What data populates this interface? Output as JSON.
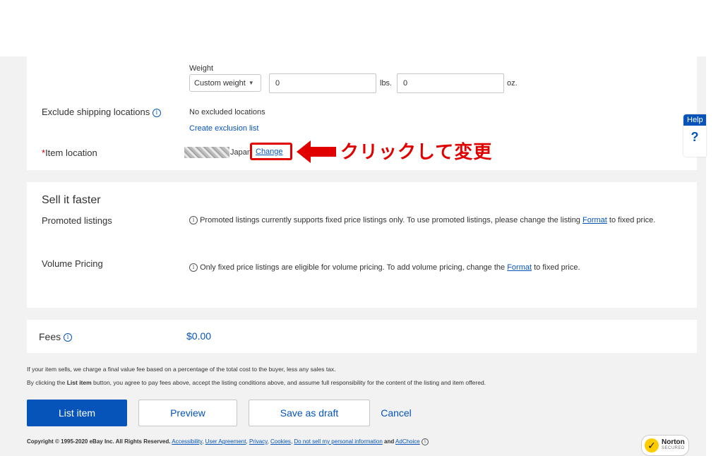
{
  "shipping": {
    "weight_label": "Weight",
    "weight_type": "Custom weight",
    "lbs_value": "0",
    "lbs_unit": "lbs.",
    "oz_value": "0",
    "oz_unit": "oz.",
    "exclude_label": "Exclude shipping locations",
    "exclude_value": "No excluded locations",
    "create_exclusion_link": "Create exclusion list",
    "item_location_required": "*",
    "item_location_label": "Item location",
    "item_location_country": "Japan",
    "change_link": "Change"
  },
  "annotation": {
    "text": "クリックして変更",
    "color": "#e10000"
  },
  "help": {
    "label": "Help",
    "icon": "question-icon"
  },
  "sell_faster": {
    "title": "Sell it faster",
    "promoted_label": "Promoted listings",
    "promoted_text": "Promoted listings currently supports fixed price listings only. To use promoted listings, please change the listing",
    "promoted_format_link": "Format",
    "promoted_tail": "to fixed price.",
    "volume_label": "Volume Pricing",
    "volume_text": "Only fixed price listings are eligible for volume pricing. To add volume pricing, change the",
    "volume_format_link": "Format",
    "volume_tail": "to fixed price."
  },
  "fees": {
    "label": "Fees",
    "amount": "$0.00",
    "disclaimer": "If your item sells, we charge a final value fee based on a percentage of the total cost to the buyer, less any sales tax.",
    "agree_prefix": "By clicking the",
    "agree_bold": "List item",
    "agree_suffix": "button, you agree to pay fees above, accept the listing conditions above, and assume full responsibility for the content of the listing and item offered."
  },
  "actions": {
    "list_item": "List item",
    "preview": "Preview",
    "save_draft": "Save as draft",
    "cancel": "Cancel"
  },
  "footer": {
    "copyright": "Copyright © 1995-2020 eBay Inc. All Rights Reserved.",
    "links": [
      "Accessibility",
      "User Agreement",
      "Privacy",
      "Cookies",
      "Do not sell my personal information"
    ],
    "and": "and",
    "adchoice": "AdChoice"
  },
  "norton": {
    "brand": "Norton",
    "sub": "SECURED"
  },
  "colors": {
    "accent": "#0654ba",
    "annotation_red": "#e10000",
    "page_bg": "#f2f2f2"
  }
}
